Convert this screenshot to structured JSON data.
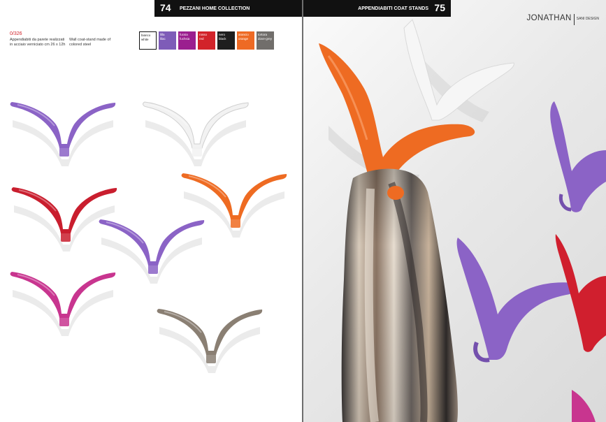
{
  "header": {
    "left_page_number": "74",
    "left_title": "PEZZANI HOME COLLECTION",
    "right_title": "APPENDIABITI COAT STANDS",
    "right_page_number": "75"
  },
  "product": {
    "code": "0/326",
    "description_it": "Appendiabiti da parete realizzati in acciaio verniciato cm 26 x 12h",
    "description_en": "Wall coat-stand made of colored steel"
  },
  "brand": {
    "name": "JONATHAN",
    "designer": "SANI DESIGN"
  },
  "swatches": [
    {
      "label_it": "bianco",
      "label_en": "white",
      "color": "#ffffff"
    },
    {
      "label_it": "lilla",
      "label_en": "lilac",
      "color": "#7e5cb8"
    },
    {
      "label_it": "fucsia",
      "label_en": "fuchsia",
      "color": "#9b1f8f"
    },
    {
      "label_it": "rosso",
      "label_en": "red",
      "color": "#d2232a"
    },
    {
      "label_it": "nero",
      "label_en": "black",
      "color": "#1e1e1e"
    },
    {
      "label_it": "arancio",
      "label_en": "orange",
      "color": "#ee6a24"
    },
    {
      "label_it": "tortora",
      "label_en": "dove-grey",
      "color": "#716e6b"
    }
  ],
  "hook_colors": {
    "lilac": "#8b63c6",
    "white": "#f2f2f2",
    "red": "#c91e2e",
    "orange": "#ee6b22",
    "fuchsia": "#c8358f",
    "dove_grey": "#8a7f73"
  }
}
